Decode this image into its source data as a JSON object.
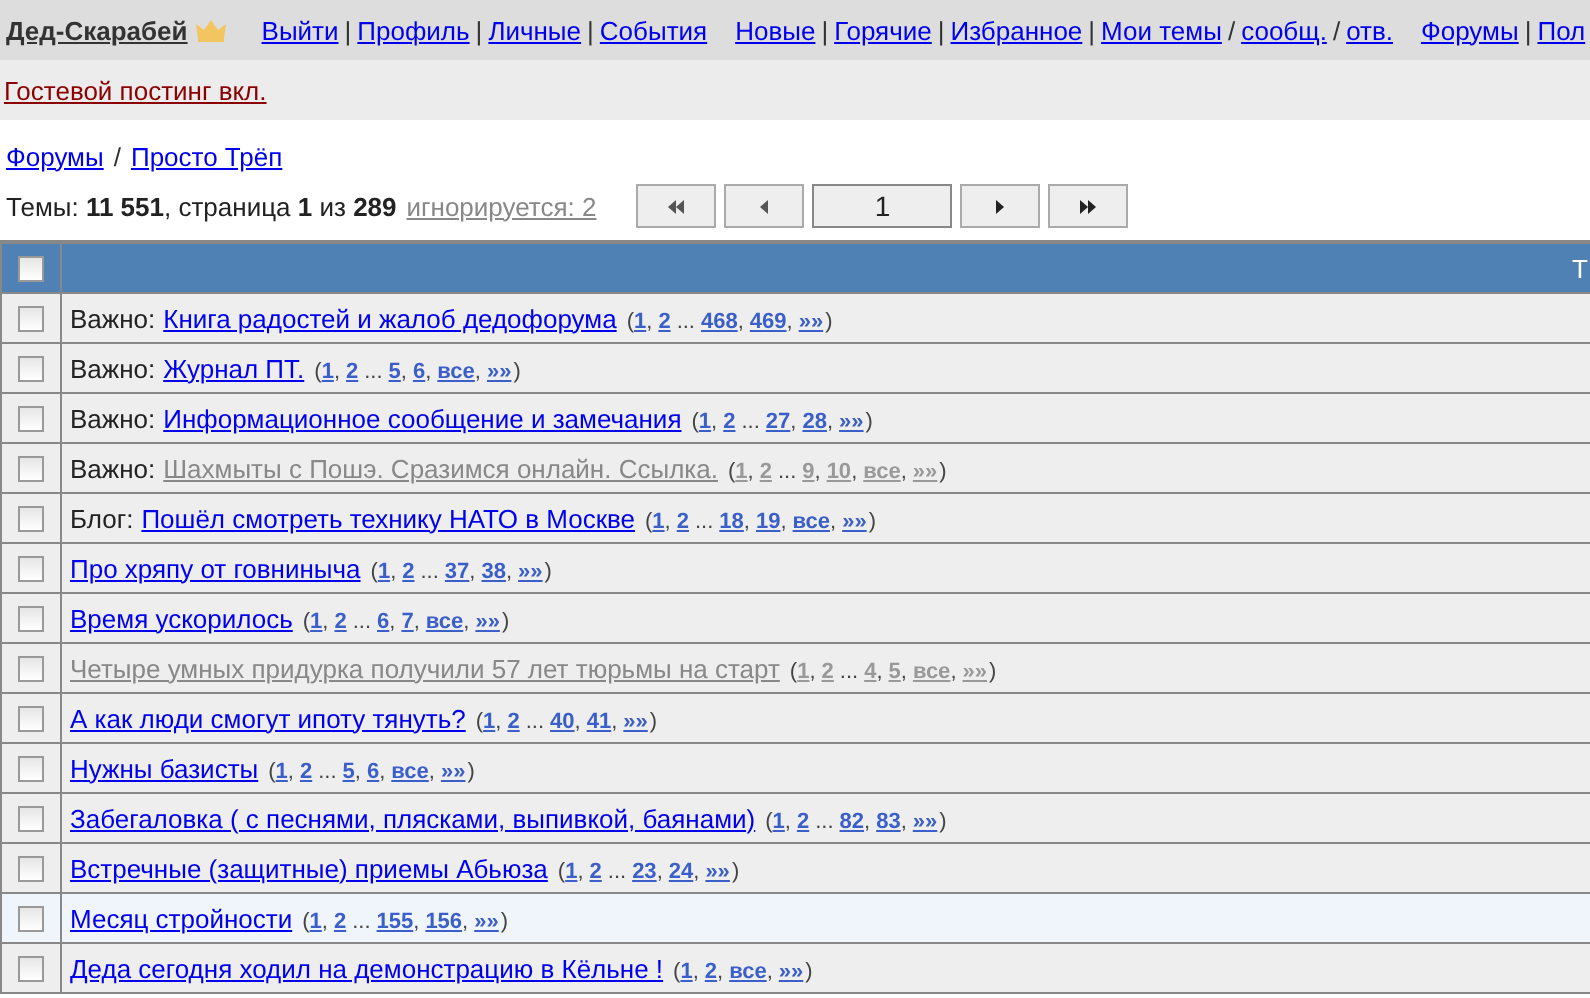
{
  "user": {
    "name": "Дед-Скарабей"
  },
  "nav": [
    [
      {
        "kind": "link",
        "text": "Выйти"
      },
      {
        "kind": "sep",
        "text": "|"
      },
      {
        "kind": "link",
        "text": "Профиль"
      },
      {
        "kind": "sep",
        "text": "|"
      },
      {
        "kind": "link",
        "text": "Личные"
      },
      {
        "kind": "sep",
        "text": "|"
      },
      {
        "kind": "link",
        "text": "События"
      }
    ],
    [
      {
        "kind": "link",
        "text": "Новые"
      },
      {
        "kind": "sep",
        "text": "|"
      },
      {
        "kind": "link",
        "text": "Горячие"
      },
      {
        "kind": "sep",
        "text": "|"
      },
      {
        "kind": "link",
        "text": "Избранное"
      },
      {
        "kind": "sep",
        "text": "|"
      },
      {
        "kind": "link",
        "text": "Мои темы"
      },
      {
        "kind": "sep",
        "text": "/"
      },
      {
        "kind": "link",
        "text": "сообщ."
      },
      {
        "kind": "sep",
        "text": "/"
      },
      {
        "kind": "link",
        "text": "отв."
      }
    ],
    [
      {
        "kind": "link",
        "text": "Форумы"
      },
      {
        "kind": "sep",
        "text": "|"
      },
      {
        "kind": "link",
        "text": "Пол"
      }
    ]
  ],
  "notice": "Гостевой постинг вкл.",
  "breadcrumbs": [
    {
      "kind": "link",
      "text": "Форумы"
    },
    {
      "kind": "sep",
      "text": "/"
    },
    {
      "kind": "link",
      "text": "Просто Трёп"
    }
  ],
  "stats": {
    "text": "Темы: **11 551**, страница **1** из **289**",
    "ignored": "игнорируется: 2"
  },
  "pager": {
    "page": "1"
  },
  "table": {
    "header_checked": false,
    "column_2": "Т",
    "rows": [
      {
        "prefix": "Важно:",
        "title": "Книга радостей и жалоб дедофорума",
        "visited": false,
        "checked": false,
        "highlighted": false,
        "pages": [
          {
            "kind": "sep",
            "text": "("
          },
          {
            "kind": "link",
            "text": "1"
          },
          {
            "kind": "sep",
            "text": ","
          },
          {
            "kind": "link",
            "text": "2"
          },
          {
            "kind": "sep",
            "text": "..."
          },
          {
            "kind": "link",
            "text": "468"
          },
          {
            "kind": "sep",
            "text": ","
          },
          {
            "kind": "link",
            "text": "469"
          },
          {
            "kind": "sep",
            "text": ","
          },
          {
            "kind": "link",
            "text": "»»"
          },
          {
            "kind": "sep",
            "text": ")"
          }
        ]
      },
      {
        "prefix": "Важно:",
        "title": "Журнал ПТ.",
        "visited": false,
        "checked": false,
        "highlighted": false,
        "pages": [
          {
            "kind": "sep",
            "text": "("
          },
          {
            "kind": "link",
            "text": "1"
          },
          {
            "kind": "sep",
            "text": ","
          },
          {
            "kind": "link",
            "text": "2"
          },
          {
            "kind": "sep",
            "text": "..."
          },
          {
            "kind": "link",
            "text": "5"
          },
          {
            "kind": "sep",
            "text": ","
          },
          {
            "kind": "link",
            "text": "6"
          },
          {
            "kind": "sep",
            "text": ","
          },
          {
            "kind": "link",
            "text": "все"
          },
          {
            "kind": "sep",
            "text": ","
          },
          {
            "kind": "link",
            "text": "»»"
          },
          {
            "kind": "sep",
            "text": ")"
          }
        ]
      },
      {
        "prefix": "Важно:",
        "title": "Информационное сообщение и замечания",
        "visited": false,
        "checked": false,
        "highlighted": false,
        "pages": [
          {
            "kind": "sep",
            "text": "("
          },
          {
            "kind": "link",
            "text": "1"
          },
          {
            "kind": "sep",
            "text": ","
          },
          {
            "kind": "link",
            "text": "2"
          },
          {
            "kind": "sep",
            "text": "..."
          },
          {
            "kind": "link",
            "text": "27"
          },
          {
            "kind": "sep",
            "text": ","
          },
          {
            "kind": "link",
            "text": "28"
          },
          {
            "kind": "sep",
            "text": ","
          },
          {
            "kind": "link",
            "text": "»»"
          },
          {
            "kind": "sep",
            "text": ")"
          }
        ]
      },
      {
        "prefix": "Важно:",
        "title": "Шахмыты с Пошэ. Сразимся онлайн. Ссылка.",
        "visited": true,
        "checked": false,
        "highlighted": false,
        "pages": [
          {
            "kind": "sep",
            "text": "("
          },
          {
            "kind": "link",
            "text": "1"
          },
          {
            "kind": "sep",
            "text": ","
          },
          {
            "kind": "link",
            "text": "2"
          },
          {
            "kind": "sep",
            "text": "..."
          },
          {
            "kind": "link",
            "text": "9"
          },
          {
            "kind": "sep",
            "text": ","
          },
          {
            "kind": "link",
            "text": "10"
          },
          {
            "kind": "sep",
            "text": ","
          },
          {
            "kind": "link",
            "text": "все"
          },
          {
            "kind": "sep",
            "text": ","
          },
          {
            "kind": "link",
            "text": "»»"
          },
          {
            "kind": "sep",
            "text": ")"
          }
        ]
      },
      {
        "prefix": "Блог:",
        "title": "Пошёл смотреть технику НАТО в Москве",
        "visited": false,
        "checked": false,
        "highlighted": false,
        "pages": [
          {
            "kind": "sep",
            "text": "("
          },
          {
            "kind": "link",
            "text": "1"
          },
          {
            "kind": "sep",
            "text": ","
          },
          {
            "kind": "link",
            "text": "2"
          },
          {
            "kind": "sep",
            "text": "..."
          },
          {
            "kind": "link",
            "text": "18"
          },
          {
            "kind": "sep",
            "text": ","
          },
          {
            "kind": "link",
            "text": "19"
          },
          {
            "kind": "sep",
            "text": ","
          },
          {
            "kind": "link",
            "text": "все"
          },
          {
            "kind": "sep",
            "text": ","
          },
          {
            "kind": "link",
            "text": "»»"
          },
          {
            "kind": "sep",
            "text": ")"
          }
        ]
      },
      {
        "title": "Про хряпу от говниныча",
        "visited": false,
        "checked": false,
        "highlighted": false,
        "pages": [
          {
            "kind": "sep",
            "text": "("
          },
          {
            "kind": "link",
            "text": "1"
          },
          {
            "kind": "sep",
            "text": ","
          },
          {
            "kind": "link",
            "text": "2"
          },
          {
            "kind": "sep",
            "text": "..."
          },
          {
            "kind": "link",
            "text": "37"
          },
          {
            "kind": "sep",
            "text": ","
          },
          {
            "kind": "link",
            "text": "38"
          },
          {
            "kind": "sep",
            "text": ","
          },
          {
            "kind": "link",
            "text": "»»"
          },
          {
            "kind": "sep",
            "text": ")"
          }
        ]
      },
      {
        "title": "Время ускорилось",
        "visited": false,
        "checked": false,
        "highlighted": false,
        "pages": [
          {
            "kind": "sep",
            "text": "("
          },
          {
            "kind": "link",
            "text": "1"
          },
          {
            "kind": "sep",
            "text": ","
          },
          {
            "kind": "link",
            "text": "2"
          },
          {
            "kind": "sep",
            "text": "..."
          },
          {
            "kind": "link",
            "text": "6"
          },
          {
            "kind": "sep",
            "text": ","
          },
          {
            "kind": "link",
            "text": "7"
          },
          {
            "kind": "sep",
            "text": ","
          },
          {
            "kind": "link",
            "text": "все"
          },
          {
            "kind": "sep",
            "text": ","
          },
          {
            "kind": "link",
            "text": "»»"
          },
          {
            "kind": "sep",
            "text": ")"
          }
        ]
      },
      {
        "title": "Четыре умных придурка получили 57 лет тюрьмы на старт",
        "visited": true,
        "checked": false,
        "highlighted": false,
        "pages": [
          {
            "kind": "sep",
            "text": "("
          },
          {
            "kind": "link",
            "text": "1"
          },
          {
            "kind": "sep",
            "text": ","
          },
          {
            "kind": "link",
            "text": "2"
          },
          {
            "kind": "sep",
            "text": "..."
          },
          {
            "kind": "link",
            "text": "4"
          },
          {
            "kind": "sep",
            "text": ","
          },
          {
            "kind": "link",
            "text": "5"
          },
          {
            "kind": "sep",
            "text": ","
          },
          {
            "kind": "link",
            "text": "все"
          },
          {
            "kind": "sep",
            "text": ","
          },
          {
            "kind": "link",
            "text": "»»"
          },
          {
            "kind": "sep",
            "text": ")"
          }
        ]
      },
      {
        "title": "А как люди смогут ипоту тянуть?",
        "visited": false,
        "checked": false,
        "highlighted": false,
        "pages": [
          {
            "kind": "sep",
            "text": "("
          },
          {
            "kind": "link",
            "text": "1"
          },
          {
            "kind": "sep",
            "text": ","
          },
          {
            "kind": "link",
            "text": "2"
          },
          {
            "kind": "sep",
            "text": "..."
          },
          {
            "kind": "link",
            "text": "40"
          },
          {
            "kind": "sep",
            "text": ","
          },
          {
            "kind": "link",
            "text": "41"
          },
          {
            "kind": "sep",
            "text": ","
          },
          {
            "kind": "link",
            "text": "»»"
          },
          {
            "kind": "sep",
            "text": ")"
          }
        ]
      },
      {
        "title": "Нужны базисты",
        "visited": false,
        "checked": false,
        "highlighted": false,
        "pages": [
          {
            "kind": "sep",
            "text": "("
          },
          {
            "kind": "link",
            "text": "1"
          },
          {
            "kind": "sep",
            "text": ","
          },
          {
            "kind": "link",
            "text": "2"
          },
          {
            "kind": "sep",
            "text": "..."
          },
          {
            "kind": "link",
            "text": "5"
          },
          {
            "kind": "sep",
            "text": ","
          },
          {
            "kind": "link",
            "text": "6"
          },
          {
            "kind": "sep",
            "text": ","
          },
          {
            "kind": "link",
            "text": "все"
          },
          {
            "kind": "sep",
            "text": ","
          },
          {
            "kind": "link",
            "text": "»»"
          },
          {
            "kind": "sep",
            "text": ")"
          }
        ]
      },
      {
        "title": "Забегаловка ( с песнями, плясками, выпивкой, баянами)",
        "visited": false,
        "checked": false,
        "highlighted": false,
        "pages": [
          {
            "kind": "sep",
            "text": "("
          },
          {
            "kind": "link",
            "text": "1"
          },
          {
            "kind": "sep",
            "text": ","
          },
          {
            "kind": "link",
            "text": "2"
          },
          {
            "kind": "sep",
            "text": "..."
          },
          {
            "kind": "link",
            "text": "82"
          },
          {
            "kind": "sep",
            "text": ","
          },
          {
            "kind": "link",
            "text": "83"
          },
          {
            "kind": "sep",
            "text": ","
          },
          {
            "kind": "link",
            "text": "»»"
          },
          {
            "kind": "sep",
            "text": ")"
          }
        ]
      },
      {
        "title": "Встречные (защитные) приемы Абьюза",
        "visited": false,
        "checked": false,
        "highlighted": false,
        "pages": [
          {
            "kind": "sep",
            "text": "("
          },
          {
            "kind": "link",
            "text": "1"
          },
          {
            "kind": "sep",
            "text": ","
          },
          {
            "kind": "link",
            "text": "2"
          },
          {
            "kind": "sep",
            "text": "..."
          },
          {
            "kind": "link",
            "text": "23"
          },
          {
            "kind": "sep",
            "text": ","
          },
          {
            "kind": "link",
            "text": "24"
          },
          {
            "kind": "sep",
            "text": ","
          },
          {
            "kind": "link",
            "text": "»»"
          },
          {
            "kind": "sep",
            "text": ")"
          }
        ]
      },
      {
        "title": "Месяц стройности",
        "visited": false,
        "checked": false,
        "highlighted": true,
        "pages": [
          {
            "kind": "sep",
            "text": "("
          },
          {
            "kind": "link",
            "text": "1"
          },
          {
            "kind": "sep",
            "text": ","
          },
          {
            "kind": "link",
            "text": "2"
          },
          {
            "kind": "sep",
            "text": "..."
          },
          {
            "kind": "link",
            "text": "155"
          },
          {
            "kind": "sep",
            "text": ","
          },
          {
            "kind": "link",
            "text": "156"
          },
          {
            "kind": "sep",
            "text": ","
          },
          {
            "kind": "link",
            "text": "»»"
          },
          {
            "kind": "sep",
            "text": ")"
          }
        ]
      },
      {
        "title": "Деда сегодня ходил на демонстрацию в Кёльне !",
        "visited": false,
        "checked": false,
        "highlighted": false,
        "pages": [
          {
            "kind": "sep",
            "text": "("
          },
          {
            "kind": "link",
            "text": "1"
          },
          {
            "kind": "sep",
            "text": ","
          },
          {
            "kind": "link",
            "text": "2"
          },
          {
            "kind": "sep",
            "text": ","
          },
          {
            "kind": "link",
            "text": "все"
          },
          {
            "kind": "sep",
            "text": ","
          },
          {
            "kind": "link",
            "text": "»»"
          },
          {
            "kind": "sep",
            "text": ")"
          }
        ]
      }
    ]
  }
}
